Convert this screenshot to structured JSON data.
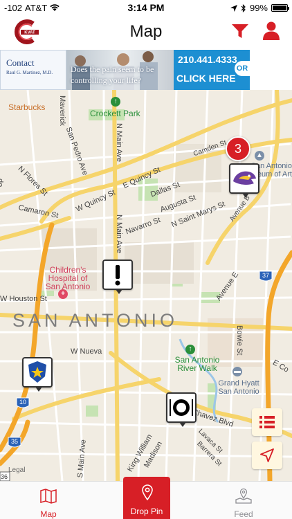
{
  "status": {
    "signal": "-102",
    "carrier": "AT&T",
    "time": "3:14 PM",
    "battery": "99%",
    "battery_level": 0.99
  },
  "header": {
    "title": "Map",
    "logo_icon": "kvat-connect-logo-icon",
    "filter_icon": "filter-funnel-icon",
    "profile_icon": "user-profile-icon",
    "accent_color": "#d71f26"
  },
  "ad": {
    "contact_title": "Contact",
    "contact_name": "Raul G. Martinez, M.D.",
    "question": "Does the pain seem to be controlling your life?",
    "phone": "210.441.4333",
    "cta": "CLICK HERE",
    "or": "OR"
  },
  "map": {
    "city": "SAN ANTONIO",
    "legal": "Legal",
    "places": {
      "starbucks": "Starbucks",
      "crockett_park": "Crockett Park",
      "childrens_hospital": "Children's Hospital of San Antonio",
      "river_walk": "San Antonio River Walk",
      "grand_hyatt": "Grand Hyatt San Antonio",
      "museum": "San Antonio Museum of Art"
    },
    "streets": {
      "maverick": "Maverick",
      "san_pedro": "San Pedro Ave",
      "n_main_top": "N Main Ave",
      "n_flores": "N Flores St",
      "quincy_w": "W Quincy St",
      "quincy_e": "E Quincy St",
      "camden": "Camden St",
      "dallas": "Dallas St",
      "augusta": "Augusta St",
      "saint_marys": "N Saint Marys St",
      "navarro": "Navarro St",
      "n_main_mid": "N Main Ave",
      "camaron": "Camaron St",
      "houston": "W Houston St",
      "avenue_e": "Avenue E",
      "avenue_b": "Avenue B",
      "nueva": "W Nueva",
      "bowie": "Bowie St",
      "chavez": "E Chavez Blvd",
      "king_william": "King William",
      "madison": "Madison",
      "lavaca": "Lavaca St",
      "barrera": "Barrera St",
      "s_main": "S Main Ave",
      "e_co": "E Co",
      "do": "do",
      "i10": "10",
      "i35": "35",
      "i37": "37",
      "r36": "36"
    },
    "cluster_count": "3",
    "pins": [
      {
        "name": "alert-pin",
        "icon": "exclamation-icon"
      },
      {
        "name": "police-pin",
        "icon": "police-badge-icon"
      },
      {
        "name": "restaurant-pin",
        "icon": "plate-cutlery-icon"
      },
      {
        "name": "mascot-pin",
        "icon": "mascot-icon"
      }
    ],
    "list_icon": "list-view-icon",
    "locate_icon": "location-arrow-icon"
  },
  "tabs": [
    {
      "label": "Map",
      "icon": "map-icon",
      "active": true,
      "color": "#d71f26"
    },
    {
      "label": "Drop Pin",
      "icon": "location-pin-icon",
      "active": false,
      "color": "#ffffff"
    },
    {
      "label": "Feed",
      "icon": "map-pin-feed-icon",
      "active": false,
      "color": "#8e8e93"
    }
  ]
}
